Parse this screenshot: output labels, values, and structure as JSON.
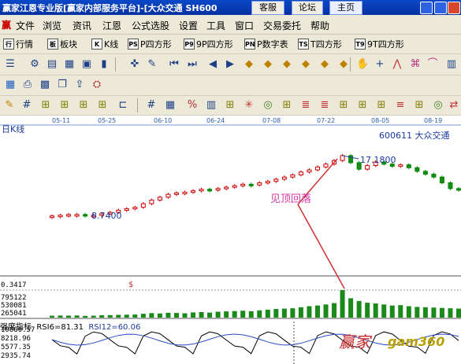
{
  "window": {
    "title": "赢家江恩专业版[赢家内部服务平台]-[大众交通 SH600",
    "tabs": [
      "客服",
      "论坛",
      "主页"
    ]
  },
  "menu": [
    "文件",
    "浏览",
    "资讯",
    "江恩",
    "公式选股",
    "设置",
    "工具",
    "窗口",
    "交易委托",
    "帮助"
  ],
  "toolbar1": [
    {
      "icon": "行",
      "label": "行情"
    },
    {
      "icon": "板",
      "label": "板块"
    },
    {
      "icon": "K",
      "label": "K线"
    },
    {
      "icon": "PS",
      "label": "P四方形"
    },
    {
      "icon": "P9",
      "label": "9P四方形"
    },
    {
      "icon": "PN",
      "label": "P数字表"
    },
    {
      "icon": "TS",
      "label": "T四方形"
    },
    {
      "icon": "T9",
      "label": "9T四方形"
    }
  ],
  "chart": {
    "title": "日K线",
    "stock_code_label": "600611 大众交通",
    "annotation": "见顶回落",
    "high_label": "17.1800",
    "low_label": "8.7400",
    "x_ticks": [
      "05-11",
      "05-25",
      "06-10",
      "06-24",
      "07-08",
      "07-22",
      "08-05",
      "08-19"
    ],
    "volume_labels": [
      "0.3417",
      "795122",
      "530081",
      "265041"
    ],
    "volume_marker": "$",
    "indicator_name": "强度指标",
    "rsi6_label": "RSI6=81.31",
    "rsi12_label": "RSI12=60.06",
    "rsi_axis_labels": [
      "10860.57",
      "8218.96",
      "5577.35",
      "2935.74"
    ],
    "watermark": "赢家",
    "watermark2": "gam360"
  },
  "chart_data": {
    "type": "bar",
    "title": "日K线",
    "x": [
      "05-11",
      "05-25",
      "06-10",
      "06-24",
      "07-08",
      "07-22",
      "08-05",
      "08-19"
    ],
    "price_high": 17.18,
    "price_low": 8.74,
    "close_series": [
      8.8,
      8.9,
      9.0,
      9.0,
      8.9,
      8.9,
      9.1,
      9.3,
      9.6,
      9.8,
      10.0,
      10.5,
      11.0,
      11.4,
      11.8,
      12.0,
      12.1,
      12.3,
      12.5,
      12.4,
      12.6,
      12.8,
      13.0,
      13.2,
      13.1,
      13.4,
      13.6,
      13.9,
      14.2,
      14.5,
      14.9,
      15.2,
      15.6,
      16.0,
      16.5,
      17.18,
      16.2,
      15.3,
      15.8,
      16.3,
      16.0,
      15.7,
      15.9,
      15.5,
      15.0,
      14.6,
      14.2,
      13.4,
      12.6,
      12.5
    ],
    "volume_series": [
      55,
      60,
      58,
      62,
      50,
      55,
      70,
      72,
      80,
      85,
      90,
      110,
      130,
      120,
      140,
      135,
      125,
      150,
      160,
      145,
      170,
      180,
      190,
      200,
      185,
      210,
      230,
      250,
      260,
      270,
      300,
      330,
      350,
      380,
      420,
      795,
      560,
      480,
      430,
      410,
      380,
      350,
      360,
      330,
      310,
      300,
      290,
      280,
      270,
      260
    ],
    "volume_ylim": [
      0,
      795122
    ],
    "rsi6_last": 81.31,
    "rsi12_last": 60.06
  }
}
